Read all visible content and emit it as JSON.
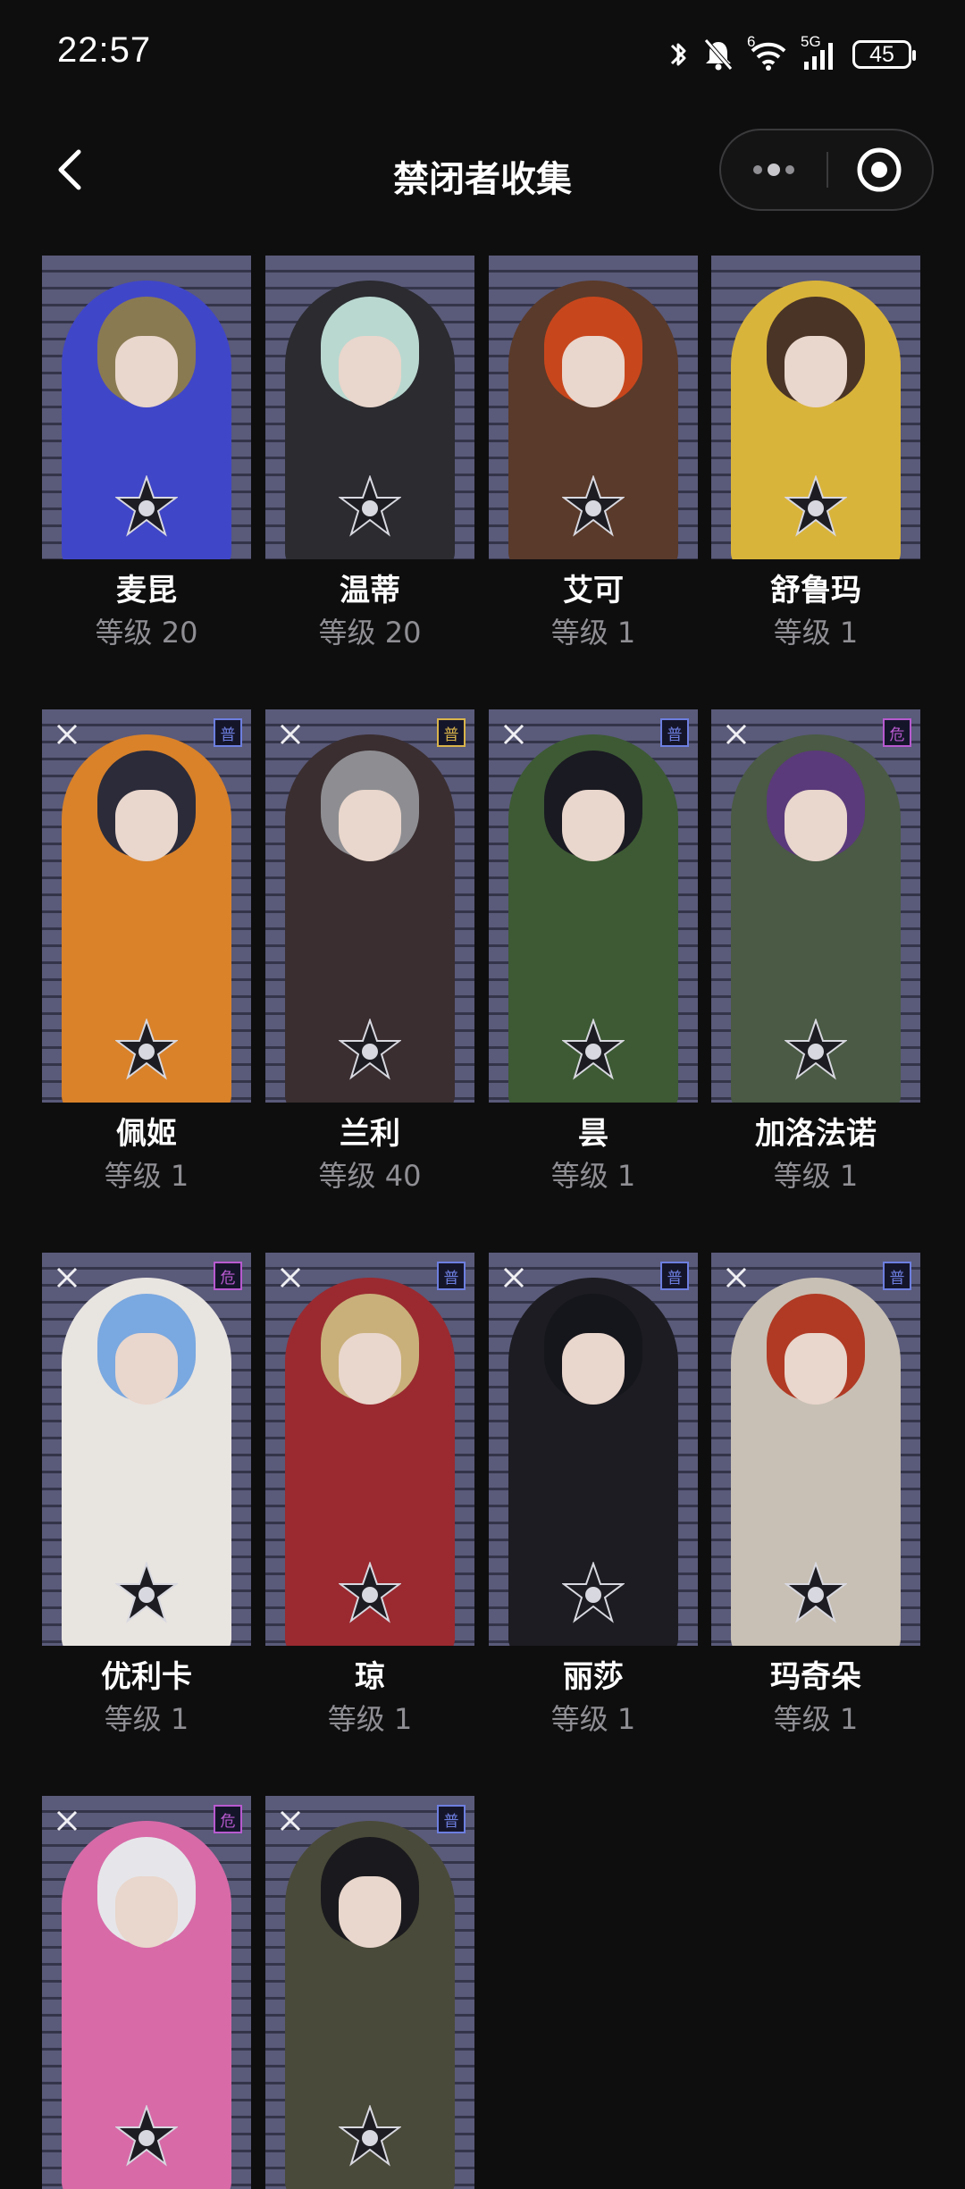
{
  "status_bar": {
    "time": "22:57",
    "battery": "45",
    "signal_label": "5G",
    "wifi_label": "6",
    "icons": [
      "bluetooth-icon",
      "bell-muted-icon",
      "wifi-icon",
      "signal-icon",
      "battery-icon"
    ]
  },
  "nav": {
    "title": "禁闭者收集",
    "back_icon": "chevron-left-icon",
    "menu_icon": "more-dots-icon",
    "close_icon": "target-close-icon"
  },
  "level_prefix": "等级",
  "characters": [
    {
      "name": "麦昆",
      "level": "等级 20",
      "theme": "#4046c8",
      "hair": "#8a7a52",
      "has_badge": false,
      "badge": "",
      "badge_color": ""
    },
    {
      "name": "温蒂",
      "level": "等级 20",
      "theme": "#2b2b30",
      "hair": "#b9d8d0",
      "has_badge": false,
      "badge": "",
      "badge_color": ""
    },
    {
      "name": "艾可",
      "level": "等级 1",
      "theme": "#5a3a2a",
      "hair": "#c8461c",
      "has_badge": false,
      "badge": "",
      "badge_color": ""
    },
    {
      "name": "舒鲁玛",
      "level": "等级 1",
      "theme": "#d9b43a",
      "hair": "#4a3426",
      "has_badge": false,
      "badge": "",
      "badge_color": ""
    },
    {
      "name": "佩姬",
      "level": "等级 1",
      "theme": "#d9822a",
      "hair": "#2b2b3a",
      "has_badge": true,
      "badge": "普",
      "badge_color": "#6d7fe0"
    },
    {
      "name": "兰利",
      "level": "等级 40",
      "theme": "#3a2e30",
      "hair": "#8e8e92",
      "has_badge": true,
      "badge": "普",
      "badge_color": "#d9b44a"
    },
    {
      "name": "昙",
      "level": "等级 1",
      "theme": "#3d5a34",
      "hair": "#1a1a22",
      "has_badge": true,
      "badge": "普",
      "badge_color": "#6d7fe0"
    },
    {
      "name": "加洛法诺",
      "level": "等级 1",
      "theme": "#4a5a44",
      "hair": "#5a3a7a",
      "has_badge": true,
      "badge": "危",
      "badge_color": "#b85ad0"
    },
    {
      "name": "优利卡",
      "level": "等级 1",
      "theme": "#e8e4e0",
      "hair": "#7aa8e0",
      "has_badge": true,
      "badge": "危",
      "badge_color": "#b85ad0"
    },
    {
      "name": "琼",
      "level": "等级 1",
      "theme": "#9a2a30",
      "hair": "#c9b07a",
      "has_badge": true,
      "badge": "普",
      "badge_color": "#6d7fe0"
    },
    {
      "name": "丽莎",
      "level": "等级 1",
      "theme": "#1c1c22",
      "hair": "#15151c",
      "has_badge": true,
      "badge": "普",
      "badge_color": "#6d7fe0"
    },
    {
      "name": "玛奇朵",
      "level": "等级 1",
      "theme": "#c8c0b4",
      "hair": "#b03a24",
      "has_badge": true,
      "badge": "普",
      "badge_color": "#6d7fe0"
    },
    {
      "name": "",
      "level": "",
      "theme": "#d86aa8",
      "hair": "#e6e6ea",
      "has_badge": true,
      "badge": "危",
      "badge_color": "#b85ad0"
    },
    {
      "name": "",
      "level": "",
      "theme": "#4a4a3a",
      "hair": "#1a1a1e",
      "has_badge": true,
      "badge": "普",
      "badge_color": "#6d7fe0"
    }
  ]
}
